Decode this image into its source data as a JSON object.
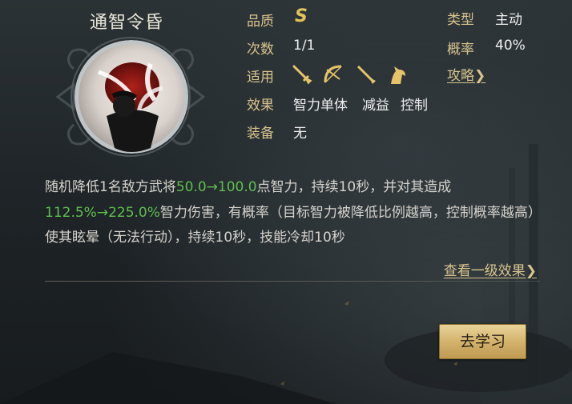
{
  "skill": {
    "name": "通智令昏",
    "portrait_icon": "skill-portrait-icon"
  },
  "attrs": {
    "quality_label": "品质",
    "quality_value": "S",
    "count_label": "次数",
    "count_value": "1/1",
    "apply_label": "适用",
    "effect_label": "效果",
    "equip_label": "装备",
    "equip_value": "无",
    "type_label": "类型",
    "type_value": "主动",
    "prob_label": "概率",
    "prob_value": "40%",
    "strategy_link": "攻略❯"
  },
  "effects": [
    "智力单体",
    "减益",
    "控制"
  ],
  "weapons": [
    "sword-icon",
    "bow-icon",
    "spear-icon",
    "horse-icon"
  ],
  "description": {
    "p1": "随机降低1名敌方武将",
    "v1": "50.0→100.0",
    "p2": "点智力，持续10秒，并对其造成",
    "v2": "112.5%→225.0%",
    "p3": "智力伤害，有概率（目标智力被降低比例越高，控制概率越高）使其眩晕（无法行动），持续10秒，技能冷却10秒"
  },
  "view_link": "查看一级效果❯",
  "learn_button": "去学习",
  "colors": {
    "gold": "#d9c48e",
    "green": "#5fbf4e",
    "button": "#d4b36d"
  }
}
